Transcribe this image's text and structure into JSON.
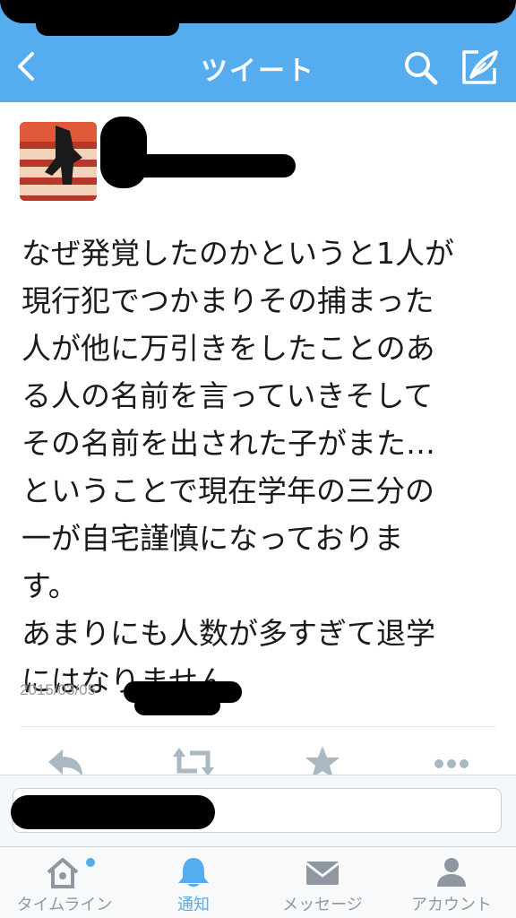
{
  "header": {
    "title": "ツイート",
    "icons": [
      "back-chevron-icon",
      "search-icon",
      "compose-icon"
    ],
    "accent_color": "#55acee"
  },
  "tweet": {
    "avatar": "profile-avatar-image",
    "text": "なぜ発覚したのかというと1人が\n現行犯でつかまりその捕まった\n人が他に万引きをしたことのあ\nる人の名前を言っていきそして\nその名前を出された子がまた…\nということで現在学年の三分の\n一が自宅謹慎になっておりま\nす。\nあまりにも人数が多すぎて退学\nにはなりません。",
    "timestamp": "2015/03/05",
    "actions": [
      "reply-icon",
      "retweet-icon",
      "favorite-icon",
      "more-icon"
    ]
  },
  "reply": {
    "value": ""
  },
  "tabs": [
    {
      "label": "タイムライン",
      "icon": "home-icon",
      "active": false,
      "dot_color": "#55acee"
    },
    {
      "label": "通知",
      "icon": "bell-icon",
      "active": true
    },
    {
      "label": "メッセージ",
      "icon": "envelope-icon",
      "active": false
    },
    {
      "label": "アカウント",
      "icon": "person-icon",
      "active": false
    }
  ],
  "colors": {
    "inactive": "#8f98a0",
    "action_icon": "#aab8c2"
  }
}
